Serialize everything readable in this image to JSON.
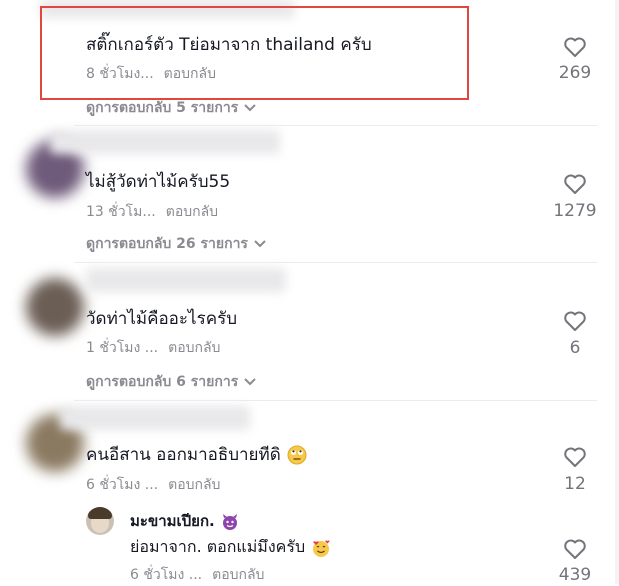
{
  "comments": [
    {
      "text": "สติ๊กเกอร์ตัว Tย่อมาจาก thailand ครับ",
      "time": "8 ชั่วโมง...",
      "reply_label": "ตอบกลับ",
      "likes": "269",
      "view_replies": "ดูการตอบกลับ 5 รายการ"
    },
    {
      "text": "ไม่สู้วัดท่าไม้ครับ55",
      "time": "13 ชั่วโม...",
      "reply_label": "ตอบกลับ",
      "likes": "1279",
      "view_replies": "ดูการตอบกลับ 26 รายการ"
    },
    {
      "text": "วัดท่าไม้คืออะไรครับ",
      "time": "1 ชั่วโมง ...",
      "reply_label": "ตอบกลับ",
      "likes": "6",
      "view_replies": "ดูการตอบกลับ 6 รายการ"
    },
    {
      "text": "คนอีสาน ออกมาอธิบายทีดิ",
      "time": "6 ชั่วโมง ...",
      "reply_label": "ตอบกลับ",
      "likes": "12",
      "emoji": "eye-roll-emoji"
    }
  ],
  "reply": {
    "username": "มะขามเปียก.",
    "username_emoji": "purple-devil-emoji",
    "text": "ย่อมาจาก. ตอกแม่มึงครับ",
    "text_emoji": "smiling-face-with-hearts-emoji",
    "time": "6 ชั่วโมง ...",
    "reply_label": "ตอบกลับ",
    "likes": "439"
  },
  "icons": {
    "like": "heart-outline-icon",
    "expand": "chevron-down-icon"
  },
  "colors": {
    "highlight": "#e2473e",
    "text": "#161823",
    "meta": "#8a8b91"
  }
}
